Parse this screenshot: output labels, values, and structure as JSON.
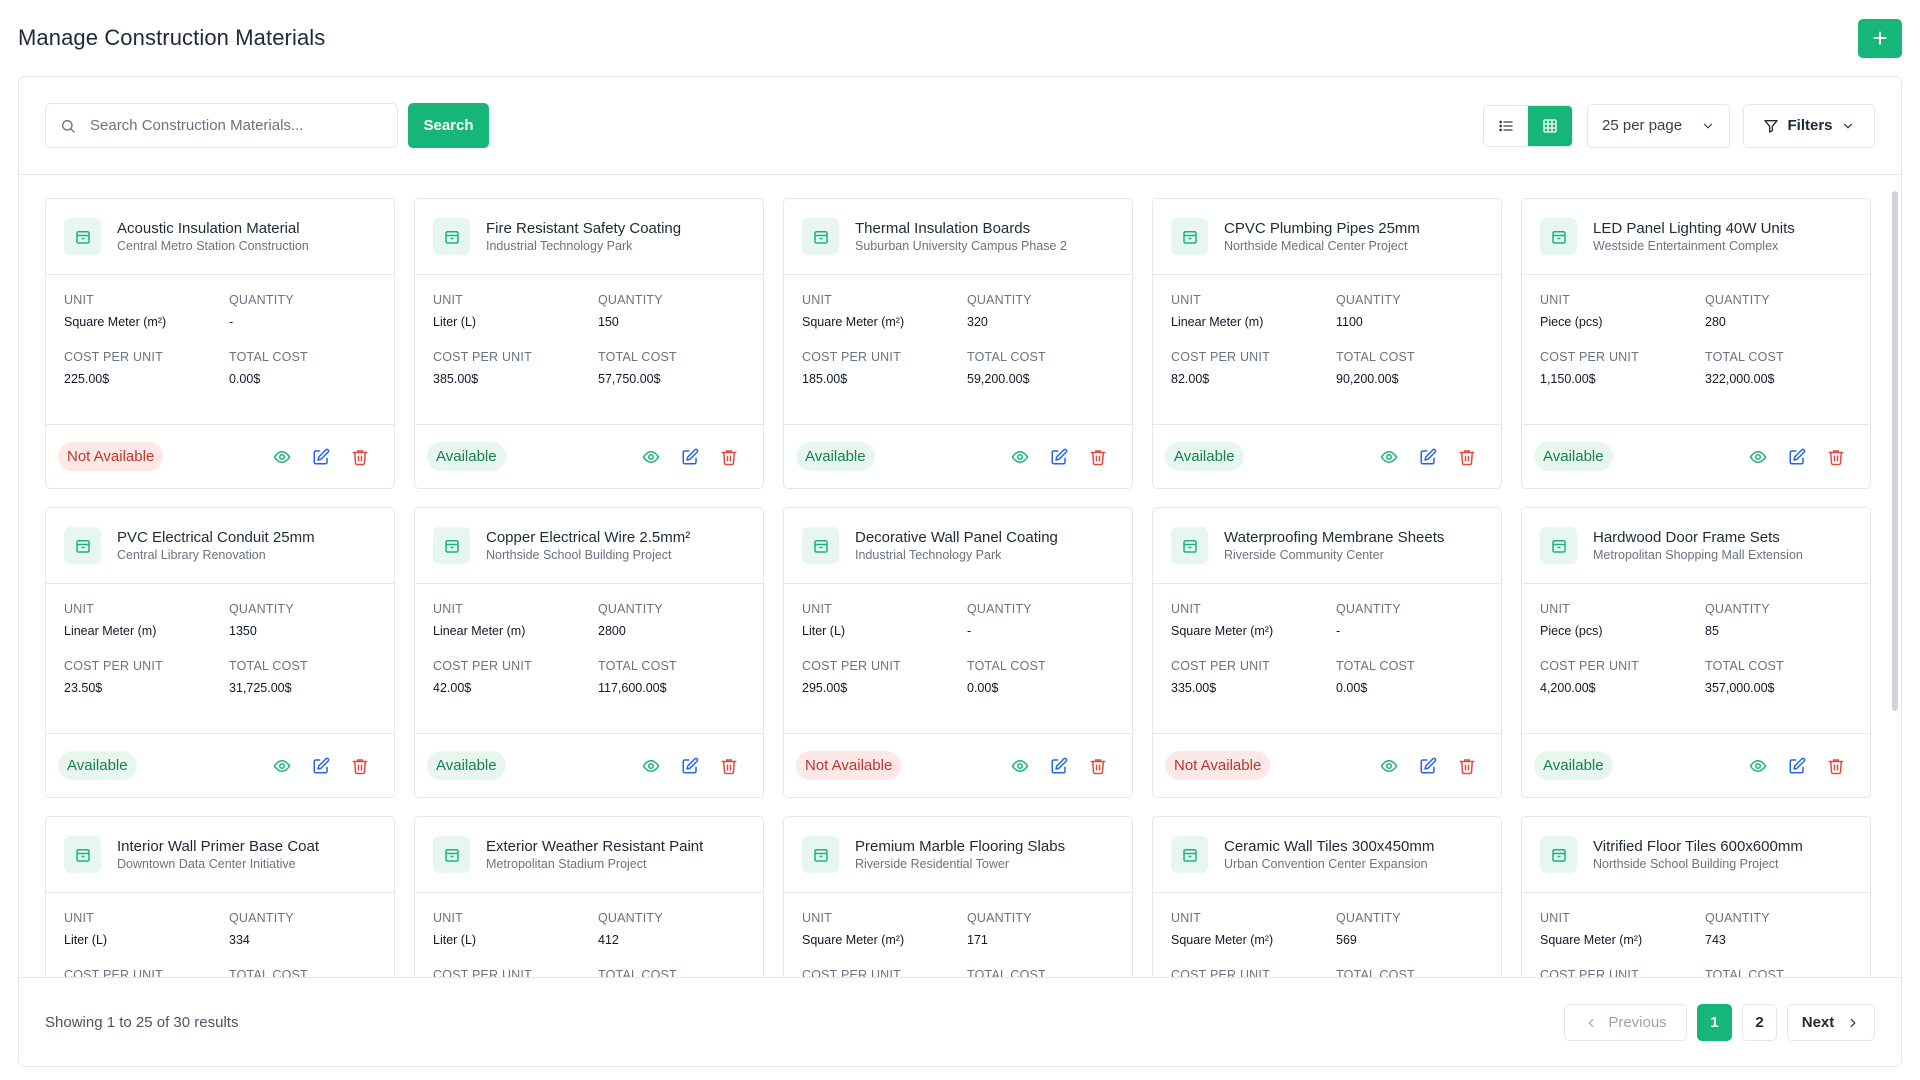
{
  "header": {
    "title": "Manage Construction Materials",
    "add_label": "+"
  },
  "toolbar": {
    "search_placeholder": "Search Construction Materials...",
    "search_label": "Search",
    "per_page": "25 per page",
    "filters_label": "Filters"
  },
  "labels": {
    "unit": "UNIT",
    "quantity": "QUANTITY",
    "cost_per_unit": "COST PER UNIT",
    "total_cost": "TOTAL COST"
  },
  "colors": {
    "accent": "#16b57a",
    "danger": "#e04a3f",
    "available_bg": "#e7f7ef",
    "not_available_bg": "#fde8e8"
  },
  "materials": [
    {
      "name": "Acoustic Insulation Material",
      "project": "Central Metro Station Construction",
      "unit": "Square Meter (m²)",
      "quantity": "-",
      "cost_per_unit": "225.00$",
      "total_cost": "0.00$",
      "status": "Not Available",
      "available": false
    },
    {
      "name": "Fire Resistant Safety Coating",
      "project": "Industrial Technology Park",
      "unit": "Liter (L)",
      "quantity": "150",
      "cost_per_unit": "385.00$",
      "total_cost": "57,750.00$",
      "status": "Available",
      "available": true
    },
    {
      "name": "Thermal Insulation Boards",
      "project": "Suburban University Campus Phase 2",
      "unit": "Square Meter (m²)",
      "quantity": "320",
      "cost_per_unit": "185.00$",
      "total_cost": "59,200.00$",
      "status": "Available",
      "available": true
    },
    {
      "name": "CPVC Plumbing Pipes 25mm",
      "project": "Northside Medical Center Project",
      "unit": "Linear Meter (m)",
      "quantity": "1100",
      "cost_per_unit": "82.00$",
      "total_cost": "90,200.00$",
      "status": "Available",
      "available": true
    },
    {
      "name": "LED Panel Lighting 40W Units",
      "project": "Westside Entertainment Complex",
      "unit": "Piece (pcs)",
      "quantity": "280",
      "cost_per_unit": "1,150.00$",
      "total_cost": "322,000.00$",
      "status": "Available",
      "available": true
    },
    {
      "name": "PVC Electrical Conduit 25mm",
      "project": "Central Library Renovation",
      "unit": "Linear Meter (m)",
      "quantity": "1350",
      "cost_per_unit": "23.50$",
      "total_cost": "31,725.00$",
      "status": "Available",
      "available": true
    },
    {
      "name": "Copper Electrical Wire 2.5mm²",
      "project": "Northside School Building Project",
      "unit": "Linear Meter (m)",
      "quantity": "2800",
      "cost_per_unit": "42.00$",
      "total_cost": "117,600.00$",
      "status": "Available",
      "available": true
    },
    {
      "name": "Decorative Wall Panel Coating",
      "project": "Industrial Technology Park",
      "unit": "Liter (L)",
      "quantity": "-",
      "cost_per_unit": "295.00$",
      "total_cost": "0.00$",
      "status": "Not Available",
      "available": false
    },
    {
      "name": "Waterproofing Membrane Sheets",
      "project": "Riverside Community Center",
      "unit": "Square Meter (m²)",
      "quantity": "-",
      "cost_per_unit": "335.00$",
      "total_cost": "0.00$",
      "status": "Not Available",
      "available": false
    },
    {
      "name": "Hardwood Door Frame Sets",
      "project": "Metropolitan Shopping Mall Extension",
      "unit": "Piece (pcs)",
      "quantity": "85",
      "cost_per_unit": "4,200.00$",
      "total_cost": "357,000.00$",
      "status": "Available",
      "available": true
    },
    {
      "name": "Interior Wall Primer Base Coat",
      "project": "Downtown Data Center Initiative",
      "unit": "Liter (L)",
      "quantity": "334",
      "cost_per_unit": "",
      "total_cost": "",
      "status": "",
      "available": true
    },
    {
      "name": "Exterior Weather Resistant Paint",
      "project": "Metropolitan Stadium Project",
      "unit": "Liter (L)",
      "quantity": "412",
      "cost_per_unit": "",
      "total_cost": "",
      "status": "",
      "available": true
    },
    {
      "name": "Premium Marble Flooring Slabs",
      "project": "Riverside Residential Tower",
      "unit": "Square Meter (m²)",
      "quantity": "171",
      "cost_per_unit": "",
      "total_cost": "",
      "status": "",
      "available": true
    },
    {
      "name": "Ceramic Wall Tiles 300x450mm",
      "project": "Urban Convention Center Expansion",
      "unit": "Square Meter (m²)",
      "quantity": "569",
      "cost_per_unit": "",
      "total_cost": "",
      "status": "",
      "available": true
    },
    {
      "name": "Vitrified Floor Tiles 600x600mm",
      "project": "Northside School Building Project",
      "unit": "Square Meter (m²)",
      "quantity": "743",
      "cost_per_unit": "",
      "total_cost": "",
      "status": "",
      "available": true
    }
  ],
  "footer": {
    "showing": "Showing 1 to 25 of 30 results",
    "previous": "Previous",
    "pages": [
      "1",
      "2"
    ],
    "current_page": "1",
    "next": "Next"
  },
  "icons": [
    "add-icon",
    "search-icon",
    "list-view-icon",
    "grid-view-icon",
    "chevron-down-icon",
    "filter-icon",
    "box-icon",
    "eye-icon",
    "edit-icon",
    "trash-icon",
    "chevron-left-icon",
    "chevron-right-icon"
  ]
}
